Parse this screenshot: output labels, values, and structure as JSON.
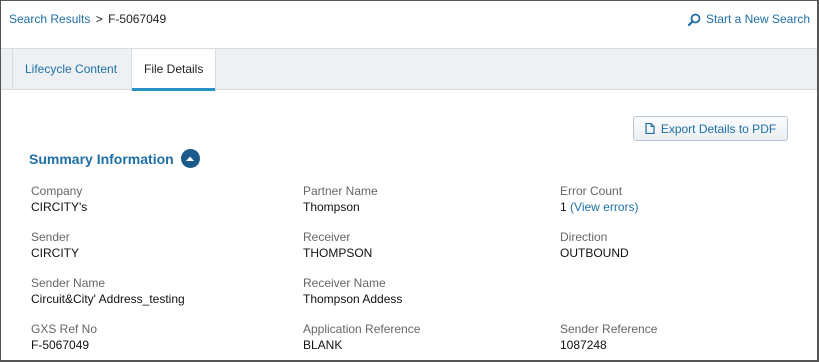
{
  "breadcrumb": {
    "parent": "Search Results",
    "separator": ">",
    "current": "F-5067049"
  },
  "header": {
    "new_search": "Start a New Search"
  },
  "tabs": [
    {
      "label": "Lifecycle Content"
    },
    {
      "label": "File Details"
    }
  ],
  "export_button": {
    "label": "Export Details to PDF"
  },
  "summary": {
    "title": "Summary Information",
    "fields": {
      "company": {
        "label": "Company",
        "value": "CIRCITY's"
      },
      "partner_name": {
        "label": "Partner Name",
        "value": "Thompson"
      },
      "error_count": {
        "label": "Error Count",
        "value": "1",
        "link": "(View errors)"
      },
      "sender": {
        "label": "Sender",
        "value": "CIRCITY"
      },
      "receiver": {
        "label": "Receiver",
        "value": "THOMPSON"
      },
      "direction": {
        "label": "Direction",
        "value": "OUTBOUND"
      },
      "sender_name": {
        "label": "Sender Name",
        "value": "Circuit&City' Address_testing"
      },
      "receiver_name": {
        "label": "Receiver Name",
        "value": "Thompson Addess"
      },
      "gxs_ref_no": {
        "label": "GXS Ref No",
        "value": "F-5067049"
      },
      "application_reference": {
        "label": "Application Reference",
        "value": "BLANK"
      },
      "sender_reference": {
        "label": "Sender Reference",
        "value": "1087248"
      }
    }
  },
  "icons": {
    "search": "search-icon",
    "pdf": "document-icon",
    "toggle": "chevron-up-icon"
  },
  "colors": {
    "link": "#1f6fa5",
    "tab_accent": "#2a90c8",
    "toggle": "#1a5b8c",
    "tabbar": "#edf1f4"
  }
}
